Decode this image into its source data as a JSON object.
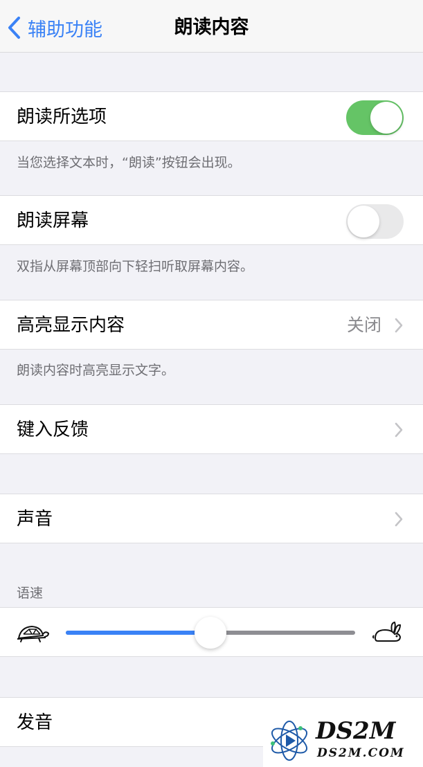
{
  "navbar": {
    "back_label": "辅助功能",
    "title": "朗读内容"
  },
  "rows": {
    "speak_selection": {
      "label": "朗读所选项",
      "toggle_on": true,
      "footer": "当您选择文本时，“朗读”按钮会出现。"
    },
    "speak_screen": {
      "label": "朗读屏幕",
      "toggle_on": false,
      "footer": "双指从屏幕顶部向下轻扫听取屏幕内容。"
    },
    "highlight": {
      "label": "高亮显示内容",
      "value": "关闭",
      "footer": "朗读内容时高亮显示文字。"
    },
    "typing_feedback": {
      "label": "键入反馈"
    },
    "voices": {
      "label": "声音"
    },
    "speaking_rate": {
      "header": "语速",
      "level": 0.5
    },
    "pronunciations": {
      "label": "发音"
    }
  },
  "watermark": {
    "text": "DS2M",
    "subtext": "DS2M.COM"
  },
  "colors": {
    "accent": "#3a82f6",
    "toggle_on": "#65c466",
    "toggle_off": "#e9e9ea",
    "background": "#f2f2f7"
  }
}
